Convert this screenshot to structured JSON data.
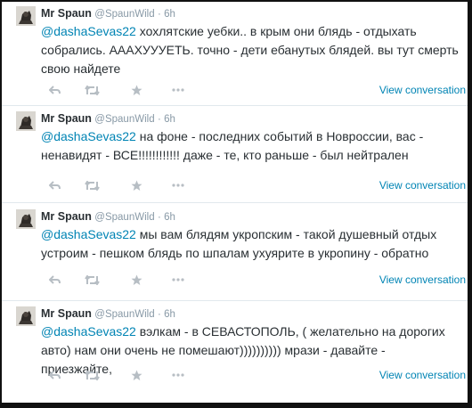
{
  "tweets": [
    {
      "name": "Mr Spaun",
      "handle": "@SpaunWild",
      "dot": "·",
      "time": "6h",
      "mention": "@dashaSevas22",
      "text": " хохлятские уебки.. в крым они блядь - отдыхать собрались. АААХУУУЕТЬ. точно - дети ебанутых блядей. вы тут смерть свою найдете",
      "view_label": "View conversation"
    },
    {
      "name": "Mr Spaun",
      "handle": "@SpaunWild",
      "dot": "·",
      "time": "6h",
      "mention": "@dashaSevas22",
      "text": " на фоне - последних событий в Новроссии, вас - ненавидят - ВСЕ!!!!!!!!!!!! даже - те, кто раньше - был нейтрален",
      "view_label": "View conversation"
    },
    {
      "name": "Mr Spaun",
      "handle": "@SpaunWild",
      "dot": "·",
      "time": "6h",
      "mention": "@dashaSevas22",
      "text": " мы вам блядям укропским - такой душевный отдых устроим - пешком блядь по шпалам ухуярите в укропину - обратно",
      "view_label": "View conversation"
    },
    {
      "name": "Mr Spaun",
      "handle": "@SpaunWild",
      "dot": "·",
      "time": "6h",
      "mention": "@dashaSevas22",
      "text": " вэлкам - в СЕВАСТОПОЛЬ, ( желательно на дорогих авто) нам они очень не помешают)))))))))) мрази - давайте - приезжайте,",
      "view_label": "View conversation"
    }
  ],
  "icons": {
    "reply": "reply-arrow-icon",
    "retweet": "retweet-icon",
    "favorite": "star-icon",
    "more": "more-dots-icon",
    "avatar": "avatar-image"
  },
  "colors": {
    "link": "#0084b4",
    "text": "#292f33",
    "meta": "#8899a6",
    "action_icon": "#b7bec4",
    "separator": "#e1e8ed"
  }
}
